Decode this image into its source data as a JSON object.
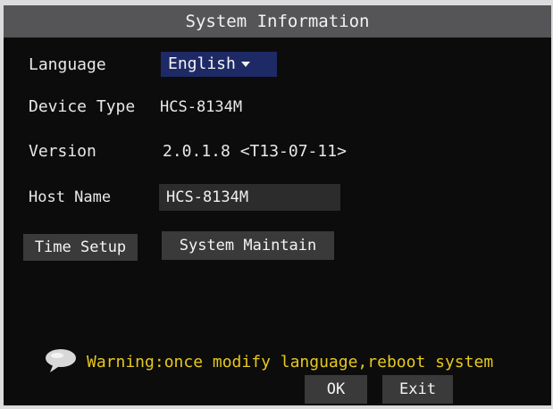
{
  "window": {
    "title": "System Information"
  },
  "form": {
    "language_label": "Language",
    "language_value": "English",
    "device_type_label": "Device Type",
    "device_type_value": "HCS-8134M",
    "version_label": "Version",
    "version_value": "2.0.1.8 <T13-07-11>",
    "host_name_label": "Host Name",
    "host_name_value": "HCS-8134M"
  },
  "buttons": {
    "time_setup": "Time Setup",
    "system_maintain": "System Maintain",
    "ok": "OK",
    "exit": "Exit"
  },
  "warning": {
    "icon": "speech-bubble-icon",
    "text": "Warning:once modify language,reboot system"
  },
  "colors": {
    "title_bar": "#555558",
    "language_select_bg": "#1e2a66",
    "warning_text": "#e6c81c"
  }
}
